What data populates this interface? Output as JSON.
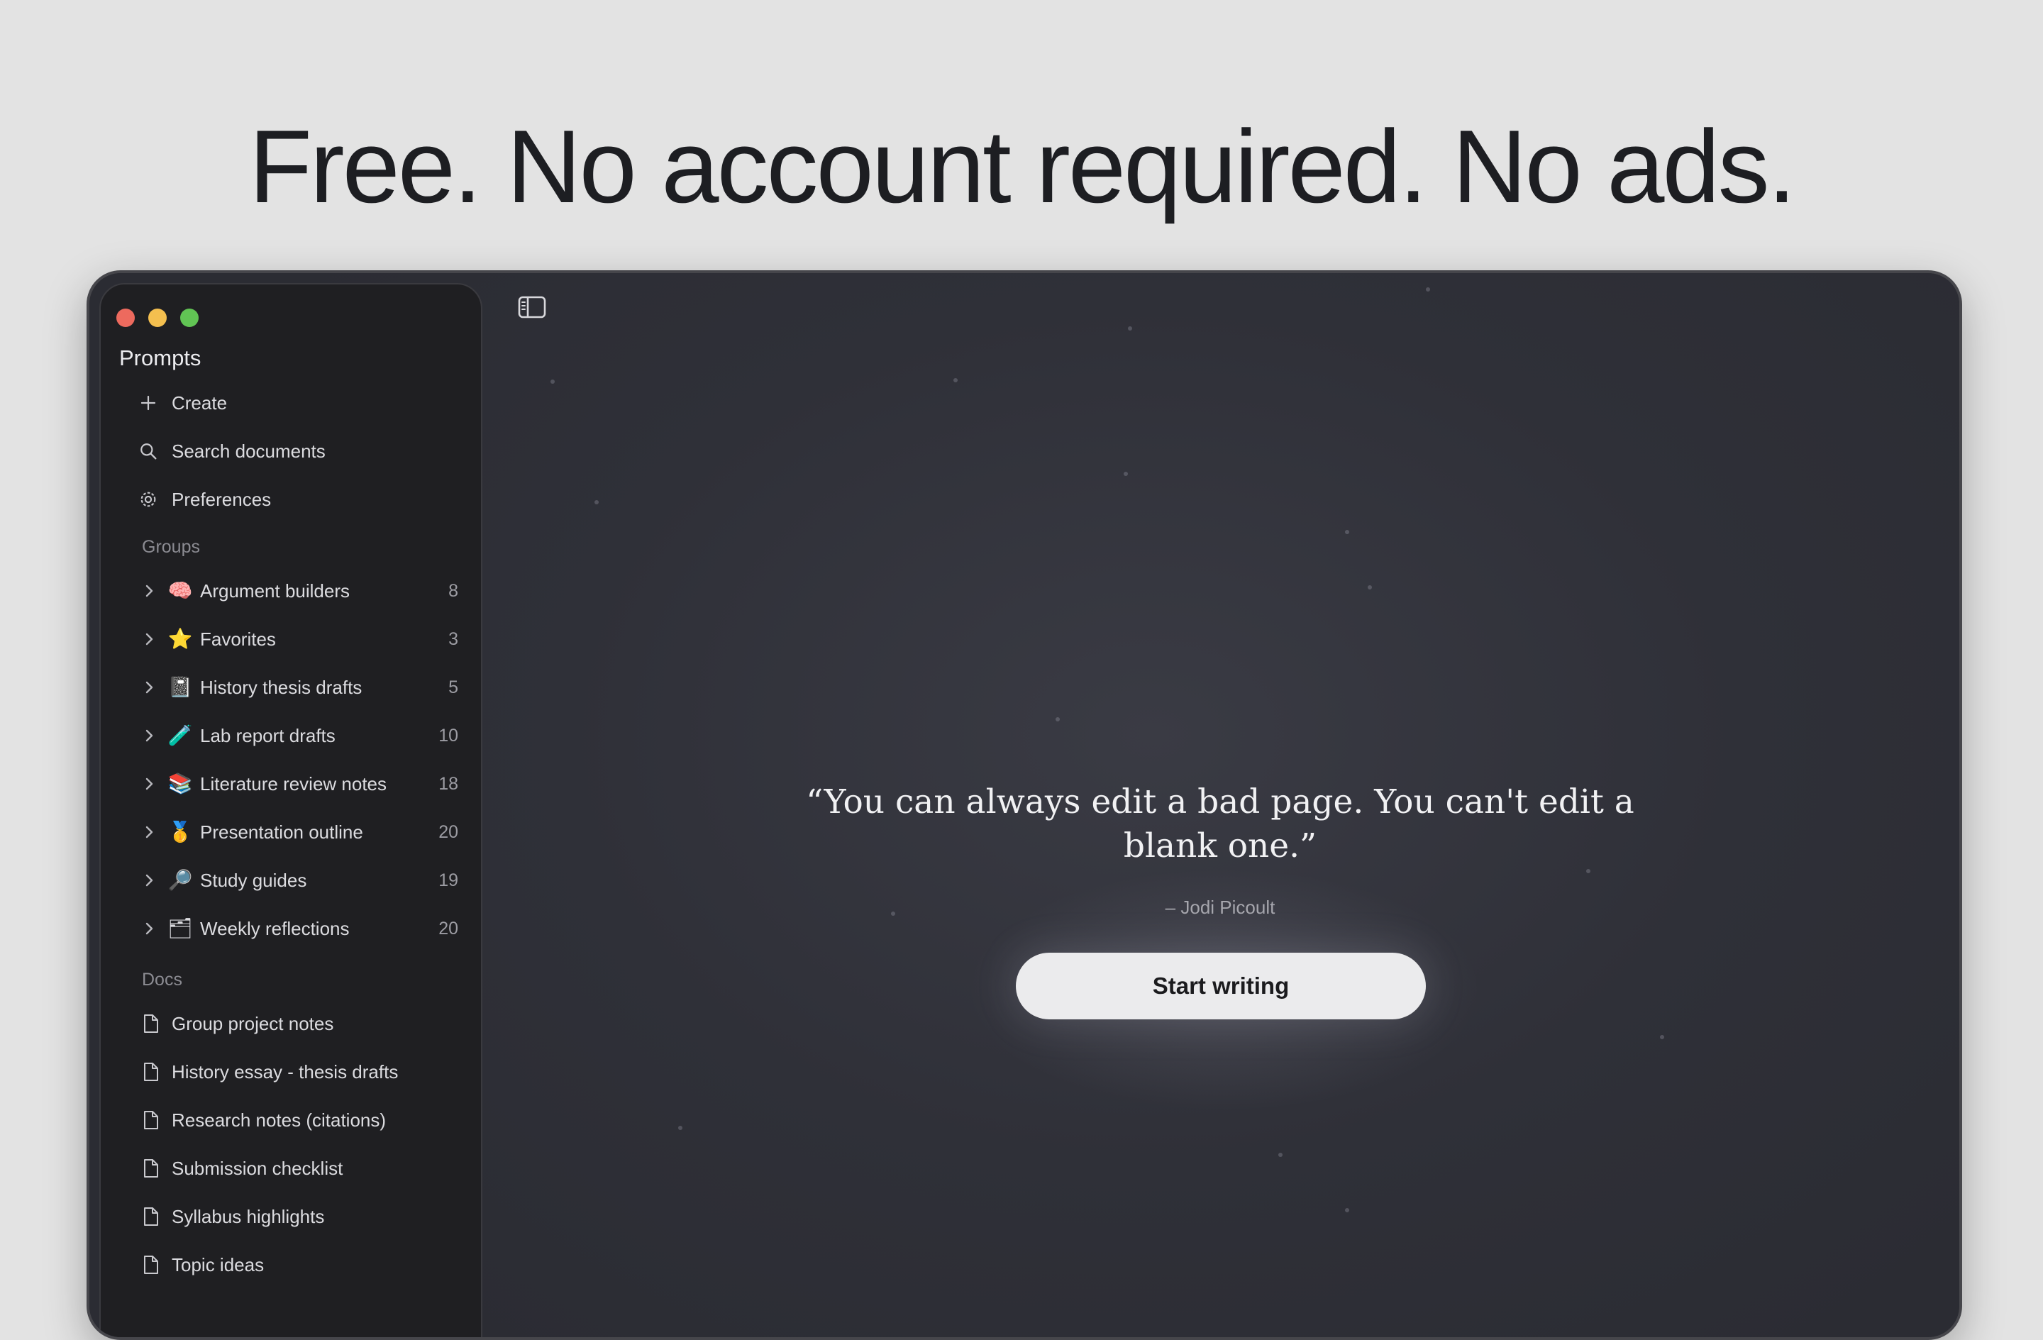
{
  "headline": "Free. No account required. No ads.",
  "sidebar": {
    "title": "Prompts",
    "menu": [
      {
        "label": "Create",
        "icon": "plus-icon"
      },
      {
        "label": "Search documents",
        "icon": "search-icon"
      },
      {
        "label": "Preferences",
        "icon": "gear-icon"
      }
    ],
    "groups_label": "Groups",
    "groups": [
      {
        "emoji": "🧠",
        "label": "Argument builders",
        "count": "8"
      },
      {
        "emoji": "⭐",
        "label": "Favorites",
        "count": "3"
      },
      {
        "emoji": "📓",
        "label": "History thesis drafts",
        "count": "5"
      },
      {
        "emoji": "🧪",
        "label": "Lab report drafts",
        "count": "10"
      },
      {
        "emoji": "📚",
        "label": "Literature review notes",
        "count": "18"
      },
      {
        "emoji": "🥇",
        "label": "Presentation outline",
        "count": "20"
      },
      {
        "emoji": "🔎",
        "label": "Study guides",
        "count": "19"
      },
      {
        "emoji": "🗂",
        "label": "Weekly reflections",
        "count": "20"
      }
    ],
    "docs_label": "Docs",
    "docs": [
      {
        "label": "Group project notes"
      },
      {
        "label": "History essay - thesis drafts"
      },
      {
        "label": "Research notes (citations)"
      },
      {
        "label": "Submission checklist"
      },
      {
        "label": "Syllabus highlights"
      },
      {
        "label": "Topic ideas"
      }
    ]
  },
  "main": {
    "quote": "“You can always edit a bad page. You can't edit a blank one.”",
    "author": "– Jodi Picoult",
    "start_button": "Start writing"
  },
  "colors": {
    "background": "#e3e3e3",
    "window": "#2c2c31",
    "sidebar": "#1f1f22",
    "close": "#ed6a5e",
    "minimize": "#f4bf4f",
    "zoom": "#61c454",
    "button": "#ebebed"
  }
}
